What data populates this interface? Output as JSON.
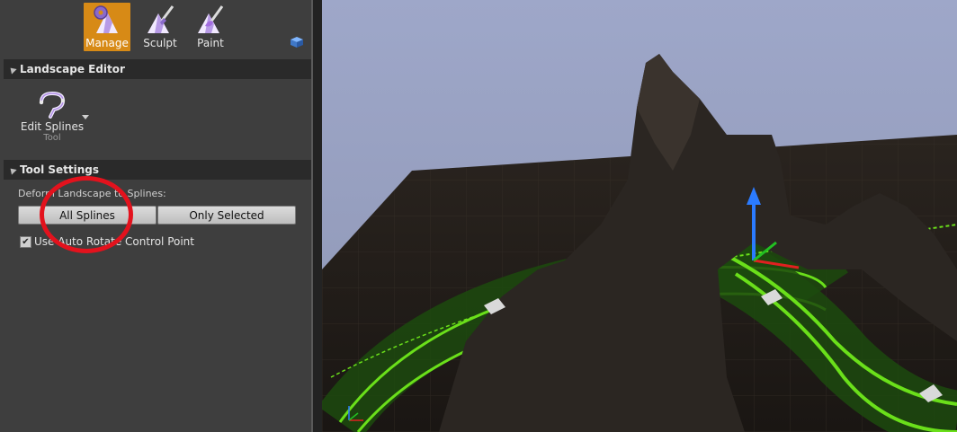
{
  "modes": [
    {
      "label": "Manage",
      "icon": "manage-icon",
      "active": true
    },
    {
      "label": "Sculpt",
      "icon": "sculpt-icon",
      "active": false
    },
    {
      "label": "Paint",
      "icon": "paint-icon",
      "active": false
    }
  ],
  "sections": {
    "landscape_editor": "Landscape Editor",
    "tool_settings": "Tool Settings"
  },
  "tool": {
    "label": "Edit Splines",
    "sublabel": "Tool",
    "icon": "spline-tool-icon"
  },
  "deform": {
    "label": "Deform Landscape to Splines:",
    "options": [
      "All Splines",
      "Only Selected"
    ]
  },
  "auto_rotate": {
    "label": "Use Auto Rotate Control Point",
    "checked": true
  },
  "colors": {
    "accent": "#d78a16",
    "highlight": "#e3121d",
    "spline_green": "#6adf1a",
    "gizmo_blue": "#2b7bff",
    "sky": "#9aa3c4"
  }
}
